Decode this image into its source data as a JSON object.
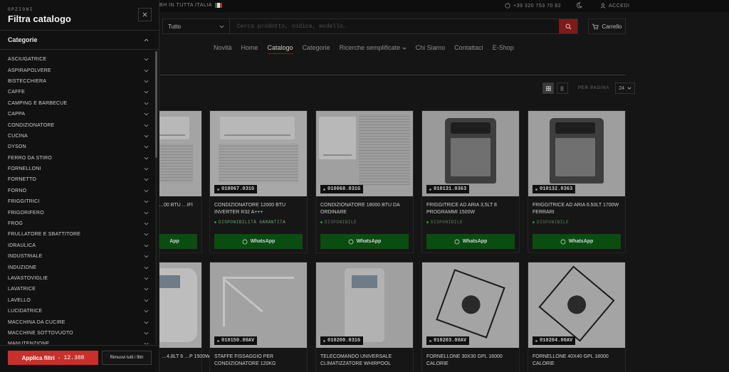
{
  "topbar": {
    "promo": "BH IN TUTTA ITALIA",
    "phone": "+39 320 753 70 82",
    "login": "ACCEDI"
  },
  "search": {
    "category": "Tutto",
    "placeholder": "Cerca prodotto, codice, modello…"
  },
  "cart": {
    "label": "Carrello"
  },
  "nav": [
    "Novità",
    "Home",
    "Catalogo",
    "Categorie",
    "Ricerche semplificate",
    "Chi Siamo",
    "Contattaci",
    "E-Shop"
  ],
  "view": {
    "per_page_label": "PER PAGINA",
    "per_page_value": "24"
  },
  "products": [
    {
      "sku": "",
      "title": "…00 BTU …IFI",
      "availability": "",
      "whatsapp": "App"
    },
    {
      "sku": "010067.031G",
      "title": "CONDIZIONATORE 12000 BTU INVERTER R32 A+++",
      "availability": "DISPONIBILITÀ GARANTITA",
      "whatsapp": "WhatsApp"
    },
    {
      "sku": "010068.031G",
      "title": "CONDIZIONATORE 18000 BTU DA ORDINARE",
      "availability": "DISPONIBILE",
      "whatsapp": "WhatsApp"
    },
    {
      "sku": "010131.0363",
      "title": "FRIGGITRICE AD ARIA 3,5LT 8 PROGRAMMI 1500W",
      "availability": "DISPONIBILE",
      "whatsapp": "WhatsApp"
    },
    {
      "sku": "010132.0363",
      "title": "FRIGGITRICE AD ARIA 6.50LT 1700W FERRARI",
      "availability": "DISPONIBILE",
      "whatsapp": "WhatsApp"
    },
    {
      "sku": "",
      "title": "…4,8LT 6 …P 1500W",
      "availability": "",
      "whatsapp": ""
    },
    {
      "sku": "010150.00AV",
      "title": "STAFFE FISSAGGIO PER CONDIZIONATORE 120KG",
      "availability": "",
      "whatsapp": ""
    },
    {
      "sku": "010200.031G",
      "title": "TELECOMANDO UNIVERSALE CLIMATIZZATORE WHIRPOOL",
      "availability": "",
      "whatsapp": ""
    },
    {
      "sku": "010203.00AV",
      "title": "FORNELLONE 30X30 GPL 16000 CALORIE",
      "availability": "",
      "whatsapp": ""
    },
    {
      "sku": "010204.00AV",
      "title": "FORNELLONE 40X40 GPL 18000 CALORIE",
      "availability": "",
      "whatsapp": ""
    }
  ],
  "sidebar": {
    "kicker": "OPZIONI",
    "title": "Filtra catalogo",
    "section": "Categorie",
    "categories": [
      "ASCIUGATRICE",
      "ASPIRAPOLVERE",
      "BISTECCHIERA",
      "CAFFE",
      "CAMPING E BARBECUE",
      "CAPPA",
      "CONDIZIONATORE",
      "CUCINA",
      "DYSON",
      "FERRO DA STIRO",
      "FORNELLONI",
      "FORNETTO",
      "FORNO",
      "FRIGGITRICI",
      "FRIGORIFERO",
      "FROG",
      "FRULLATORE E SBATTITORE",
      "IDRAULICA",
      "INDUSTRIALE",
      "INDUZIONE",
      "LAVASTOVIGLIE",
      "LAVATRICE",
      "LAVELLO",
      "LUCIDATRICE",
      "MACCHINA DA CUCIRE",
      "MACCHINE SOTTOVUOTO",
      "MANUTENZIONE"
    ],
    "apply_label": "Applica filtri",
    "apply_sep": "·",
    "apply_count": "12.388",
    "remove_label": "Rimuovi tutti i filtri"
  }
}
